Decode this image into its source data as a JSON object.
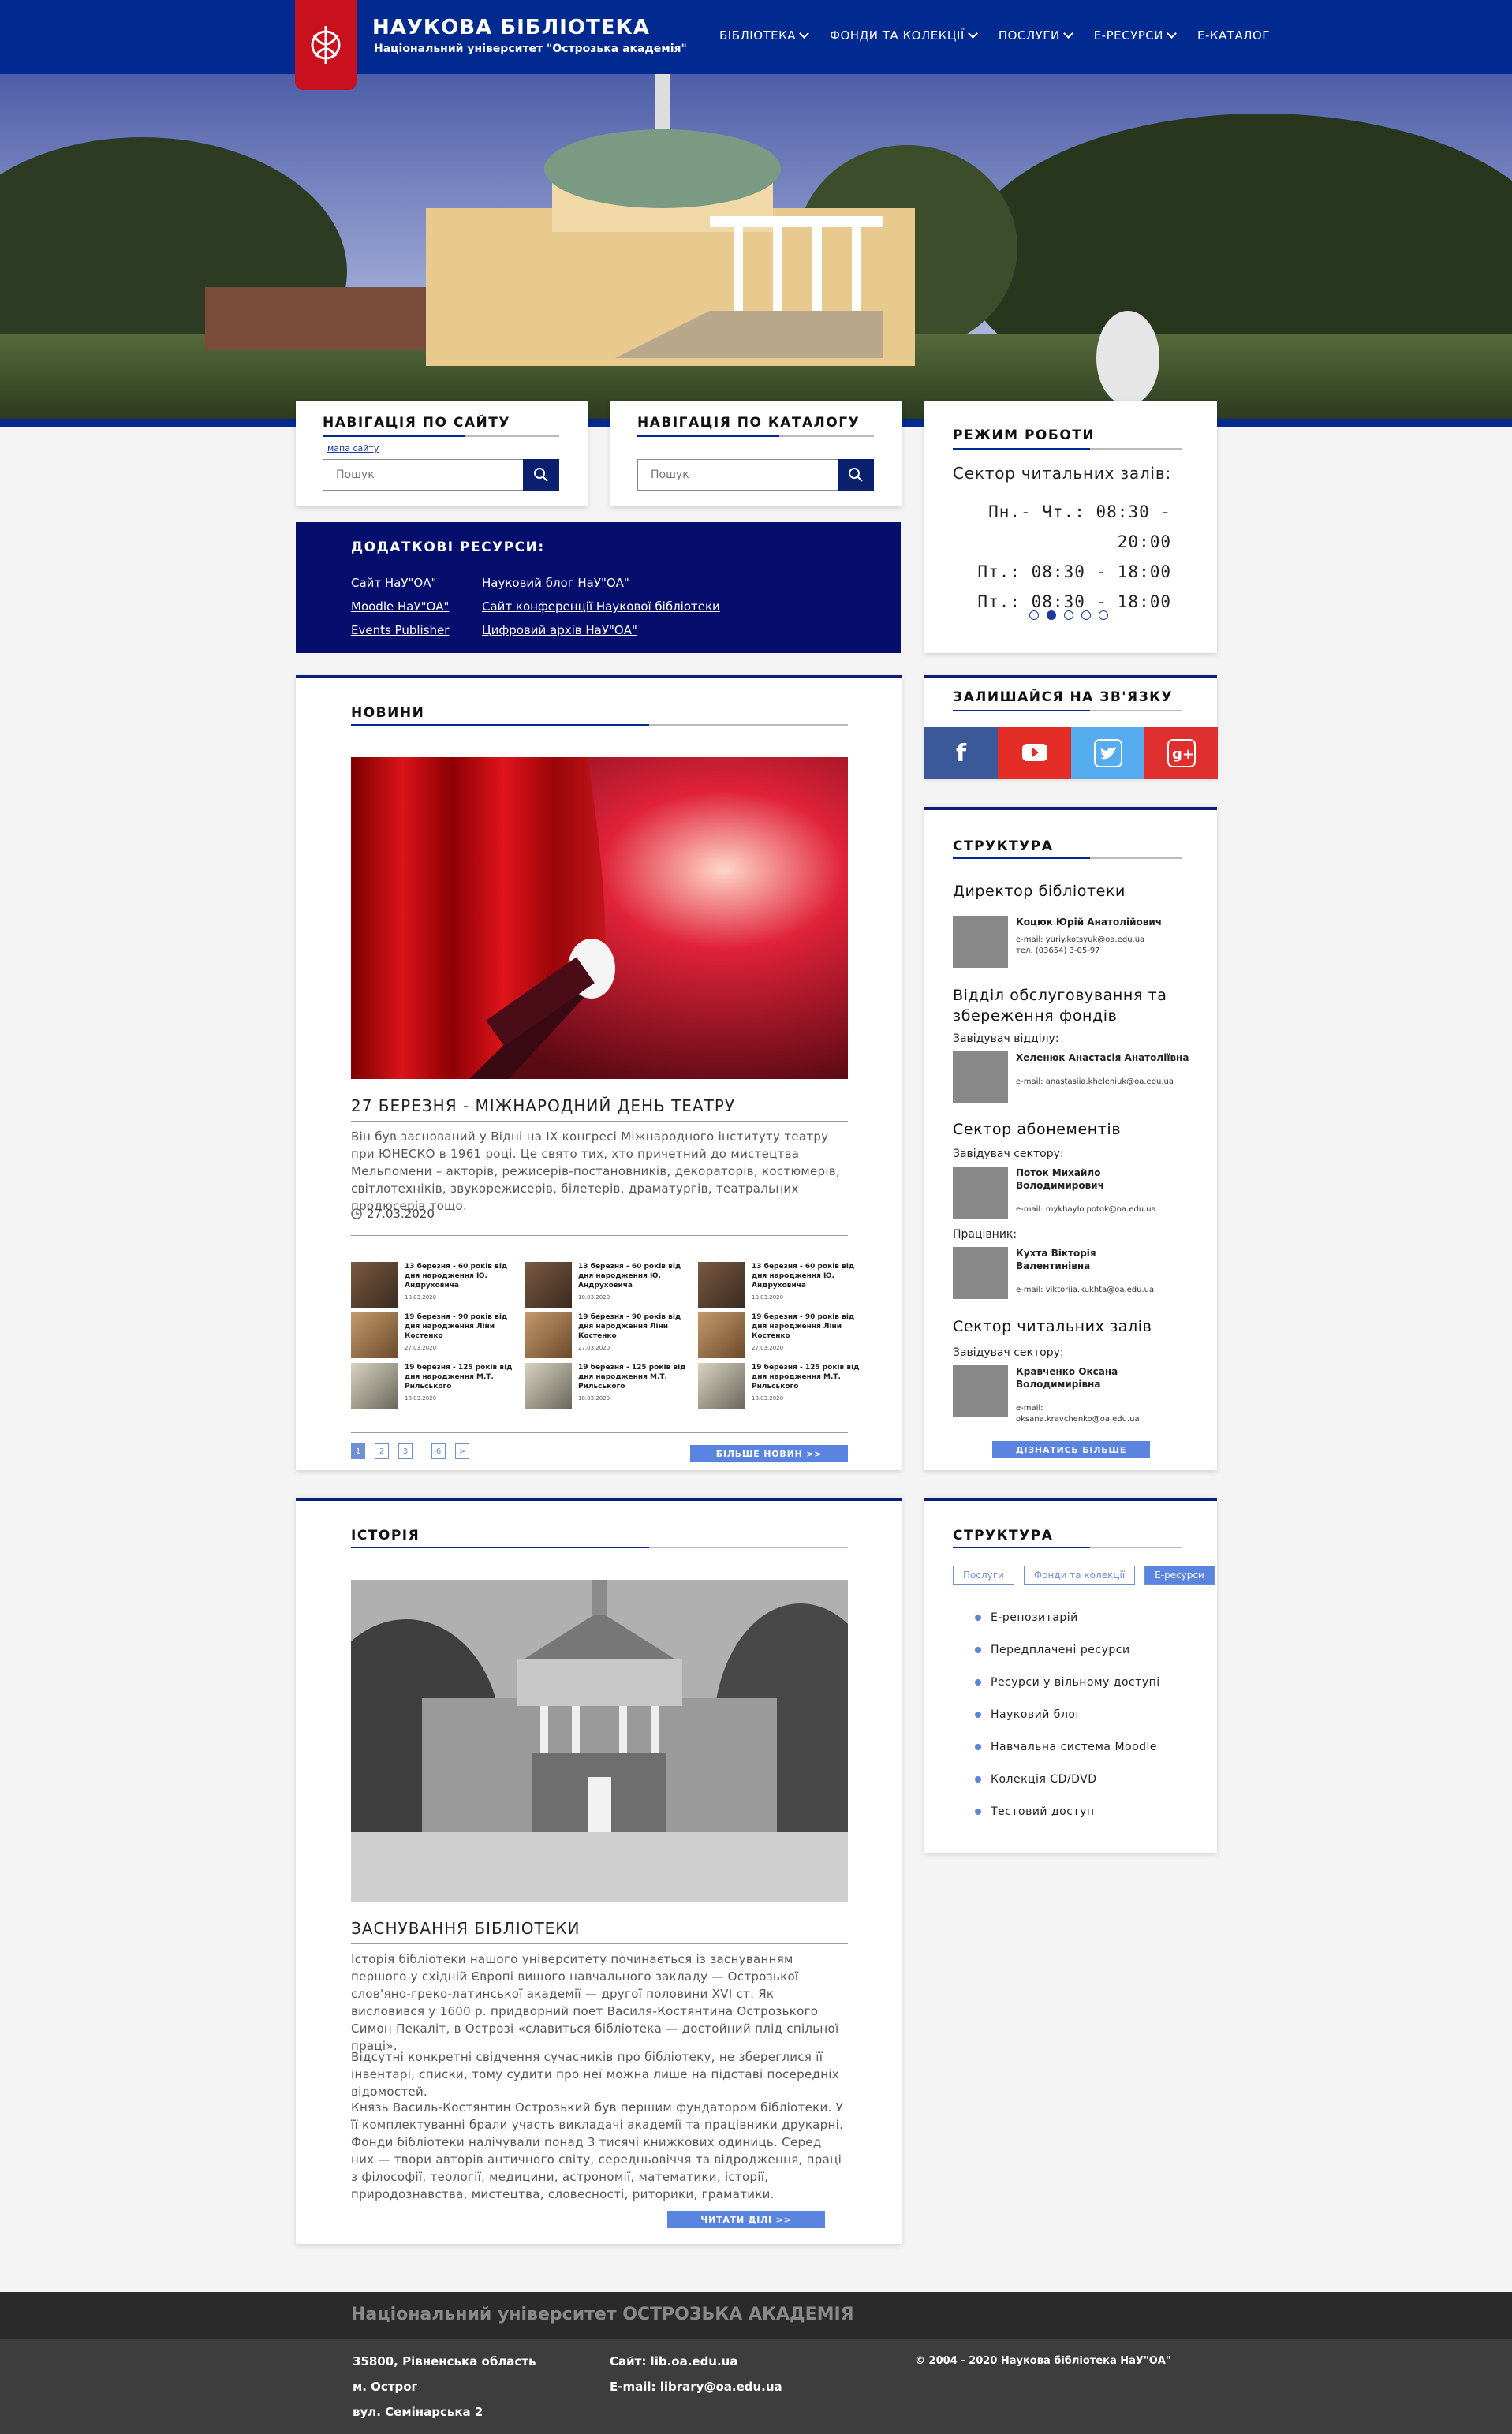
{
  "header": {
    "title": "НАУКОВА БІБЛІОТЕКА",
    "subtitle": "Національний університет \"Острозька академія\"",
    "nav": [
      {
        "label": "БІБЛІОТЕКА"
      },
      {
        "label": "ФОНДИ ТА КОЛЕКЦІЇ"
      },
      {
        "label": "ПОСЛУГИ"
      },
      {
        "label": "Е-РЕСУРСИ"
      },
      {
        "label": "Е-КАТАЛОГ"
      }
    ]
  },
  "site_nav": {
    "title": "НАВІГАЦІЯ ПО САЙТУ",
    "sitemap_link": "мапа сайту",
    "placeholder": "Пошук"
  },
  "catalog_nav": {
    "title": "НАВІГАЦІЯ ПО КАТАЛОГУ",
    "placeholder": "Пошук"
  },
  "hours": {
    "title": "РЕЖИМ РОБОТИ",
    "sector": "Сектор читальних залів:",
    "rows": [
      "Пн.- Чт.: 08:30 - 20:00",
      "Пт.: 08:30 - 18:00",
      "Пт.: 08:30 - 18:00"
    ],
    "active_slide": 2
  },
  "resources": {
    "title": "ДОДАТКОВІ РЕСУРСИ:",
    "links_left": [
      "Сайт НаУ\"ОА\"",
      "Moodle НаУ\"ОА\"",
      "Events Publisher"
    ],
    "links_right": [
      "Науковий блог НаУ\"ОА\"",
      "Сайт конференції Наукової бібліотеки",
      "Цифровий архів НаУ\"ОА\""
    ]
  },
  "news": {
    "title": "НОВИНИ",
    "headline": "27 БЕРЕЗНЯ - МІЖНАРОДНИЙ ДЕНЬ ТЕАТРУ",
    "body": "Він був заснований у Відні на IX конгресі Міжнародного інституту театру при ЮНЕСКО в 1961 році. Це свято тих, хто причетний до мистецтва Мельпомени – акторів, режисерів-постановників, декораторів, костюмерів, світлотехніків, звукорежисерів, білетерів, драматургів, театральних продюсерів тощо.",
    "date": "27.03.2020",
    "items": [
      {
        "text": "13 березня - 60 років від дня народження Ю. Андруховича",
        "date": "10.03.2020"
      },
      {
        "text": "13 березня - 60 років від дня народження Ю. Андруховича",
        "date": "10.03.2020"
      },
      {
        "text": "13 березня - 60 років від дня народження Ю. Андруховича",
        "date": "10.03.2020"
      },
      {
        "text": "19 березня - 90 років від дня народження Ліни Костенко",
        "date": "27.03.2020"
      },
      {
        "text": "19 березня - 90 років від дня народження Ліни Костенко",
        "date": "27.03.2020"
      },
      {
        "text": "19 березня - 90 років від дня народження Ліни Костенко",
        "date": "27.03.2020"
      },
      {
        "text": "19 березня - 125 років від дня народження М.Т. Рильського",
        "date": "18.03.2020"
      },
      {
        "text": "19 березня - 125 років від дня народження М.Т. Рильського",
        "date": "18.03.2020"
      },
      {
        "text": "19 березня - 125 років від дня народження М.Т. Рильського",
        "date": "18.03.2020"
      }
    ],
    "pages": [
      "1",
      "2",
      "3",
      "6",
      ">"
    ],
    "more": "БІЛЬШЕ НОВИН >>"
  },
  "social": {
    "title": "ЗАЛИШАЙСЯ НА ЗВ'ЯЗКУ",
    "colors": [
      "#3b5998",
      "#e52d27",
      "#55acee",
      "#e02f2f"
    ],
    "icons": [
      "facebook-icon",
      "youtube-icon",
      "twitter-icon",
      "google-plus-icon"
    ]
  },
  "structure": {
    "title": "СТРУКТУРА",
    "director_section": "Директор бібліотеки",
    "director_name": "Коцюк Юрій Анатолійович",
    "director_email": "e-mail: yuriy.kotsyuk@oa.edu.ua",
    "director_phone": "тел. (03654) 3-05-97",
    "dept": "Відділ обслуговування та збереження фондів",
    "dept_role": "Завідувач відділу:",
    "dept_name": "Хеленюк Анастасія Анатоліївна",
    "dept_email": "e-mail: anastasiia.khelenіuk@oa.edu.ua",
    "abon": "Сектор абонементів",
    "abon_role": "Завідувач сектору:",
    "abon_name": "Поток Михайло Володимирович",
    "abon_email": "e-mail: mykhaylo.potok@oa.edu.ua",
    "abon_role2": "Працівник:",
    "abon_name2": "Кухта Вікторія Валентинівна",
    "abon_email2": "e-mail: viktoriia.kukhta@oa.edu.ua",
    "read": "Сектор читальних залів",
    "read_role": "Завідувач сектору:",
    "read_name": "Кравченко Оксана Володимирівна",
    "read_email": "e-mail: oksana.kravchenko@oa.edu.ua",
    "more": "ДІЗНАТИСЬ БІЛЬШЕ"
  },
  "history": {
    "title": "ІСТОРІЯ",
    "headline": "ЗАСНУВАННЯ БІБЛІОТЕКИ",
    "p1": "Історія бібліотеки нашого університету починається із заснуванням першого у східній Європі вищого навчального закладу — Острозької слов'яно-греко-латинської академії — другої половини XVI ст. Як висловився у 1600 р. придворний поет Василя-Костянтина Острозького Симон Пекаліт, в Острозі «славиться бібліотека — достойний плід спільної праці».",
    "p2": "Відсутні конкретні свідчення сучасників про бібліотеку, не збереглися її інвентарі, списки, тому судити про неї можна лише на підставі посередніх відомостей.",
    "p3": "Князь Василь-Костянтин Острозький був першим фундатором бібліотеки. У її комплектуванні брали участь викладачі академії та працівники друкарні. Фонди бібліотеки налічували понад 3 тисячі книжкових одиниць. Серед них — твори авторів античного світу, середньовіччя та відродження, праці з філософії, теології, медицини, астрономії, математики, історії, природознавства, мистецтва, словесності, риторики, граматики.",
    "more": "ЧИТАТИ ДІЛІ >>"
  },
  "eres": {
    "title": "СТРУКТУРА",
    "tabs": [
      "Послуги",
      "Фонди та колекції",
      "Е-ресурси"
    ],
    "items": [
      "Е-репозитарій",
      "Передплачені ресурси",
      "Ресурси у вільному доступі",
      "Науковий блог",
      "Навчальна система Moodle",
      "Колекція CD/DVD",
      "Тестовий доступ"
    ]
  },
  "footer": {
    "university": "Національний університет ОСТРОЗЬКА АКАДЕМІЯ",
    "addr1": "35800, Рівненська область",
    "addr2": "м. Острог",
    "addr3": "вул. Семінарська 2",
    "site": "Сайт: lib.oa.edu.ua",
    "email": "E-mail: library@oa.edu.ua",
    "copyright": "© 2004 - 2020 Наукова бібліотека НаУ\"ОА\""
  }
}
